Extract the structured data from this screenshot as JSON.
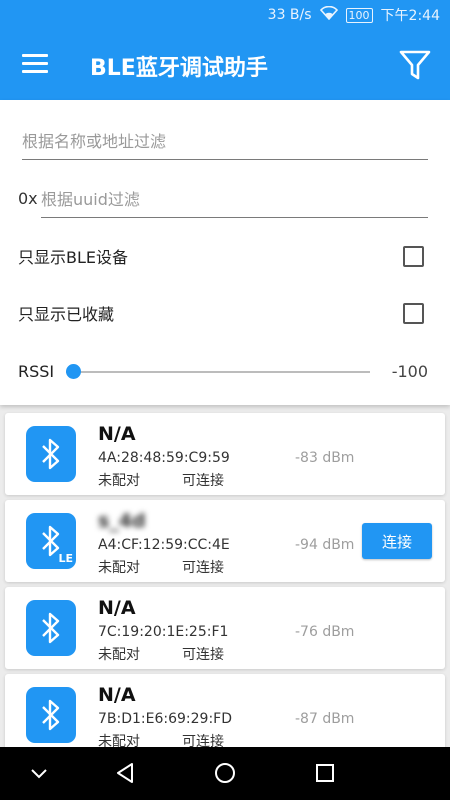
{
  "status_bar": {
    "net_speed": "33 B/s",
    "battery": "100",
    "time": "下午2:44"
  },
  "app_bar": {
    "title": "BLE蓝牙调试助手",
    "menu_icon": "hamburger-menu-icon",
    "filter_icon": "funnel-filter-icon"
  },
  "filters": {
    "name_placeholder": "根据名称或地址过滤",
    "uuid_prefix": "0x",
    "uuid_placeholder": "根据uuid过滤",
    "ble_only_label": "只显示BLE设备",
    "ble_only_checked": false,
    "favorites_only_label": "只显示已收藏",
    "favorites_only_checked": false,
    "rssi_label": "RSSI",
    "rssi_value": "-100",
    "rssi_slider_fraction": 0
  },
  "devices": [
    {
      "name": "N/A",
      "mac": "4A:28:48:59:C9:59",
      "bond": "未配对",
      "connectable": "可连接",
      "rssi": "-83 dBm",
      "le": false,
      "connect_label": ""
    },
    {
      "name": "s_4d",
      "mac": "A4:CF:12:59:CC:4E",
      "bond": "未配对",
      "connectable": "可连接",
      "rssi": "-94 dBm",
      "le": true,
      "connect_label": "连接"
    },
    {
      "name": "N/A",
      "mac": "7C:19:20:1E:25:F1",
      "bond": "未配对",
      "connectable": "可连接",
      "rssi": "-76 dBm",
      "le": false,
      "connect_label": ""
    },
    {
      "name": "N/A",
      "mac": "7B:D1:E6:69:29:FD",
      "bond": "未配对",
      "connectable": "可连接",
      "rssi": "-87 dBm",
      "le": false,
      "connect_label": ""
    }
  ],
  "colors": {
    "primary": "#2196f3",
    "rssi_text": "#9e9e9e"
  }
}
